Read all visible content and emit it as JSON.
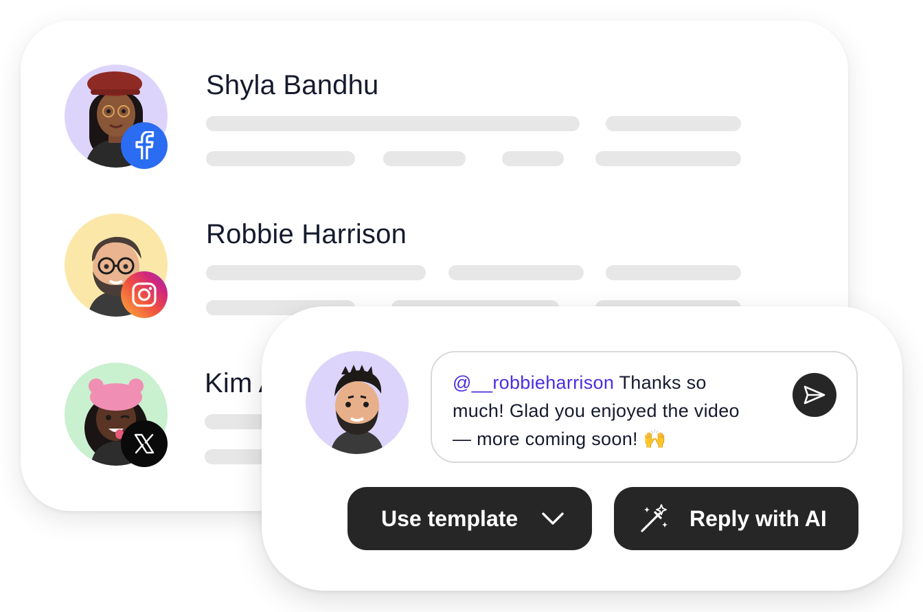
{
  "contacts": [
    {
      "name": "Shyla Bandhu",
      "network": "Facebook",
      "network_icon": "facebook-icon",
      "avatar_bg": "#ddd4fb",
      "badge_color": "#2a6cf2"
    },
    {
      "name": "Robbie Harrison",
      "network": "Instagram",
      "network_icon": "instagram-icon",
      "avatar_bg": "#fbe8a9",
      "badge_color": "#e1306c"
    },
    {
      "name": "Kim A",
      "network": "X",
      "network_icon": "x-icon",
      "avatar_bg": "#c9f0cf",
      "badge_color": "#0a0a0a"
    }
  ],
  "reply": {
    "mention": "@__robbieharrison",
    "message": " Thanks so much! Glad you enjoyed the video — more coming soon! 🙌",
    "send_icon": "send-icon",
    "avatar_bg": "#dcd4fb"
  },
  "actions": {
    "template_label": "Use template",
    "template_icon": "chevron-down-icon",
    "ai_label": "Reply with AI",
    "ai_icon": "magic-wand-icon"
  },
  "colors": {
    "mention": "#4b2ee0",
    "button_bg": "#262626",
    "placeholder_bar": "#e7e7e7"
  }
}
